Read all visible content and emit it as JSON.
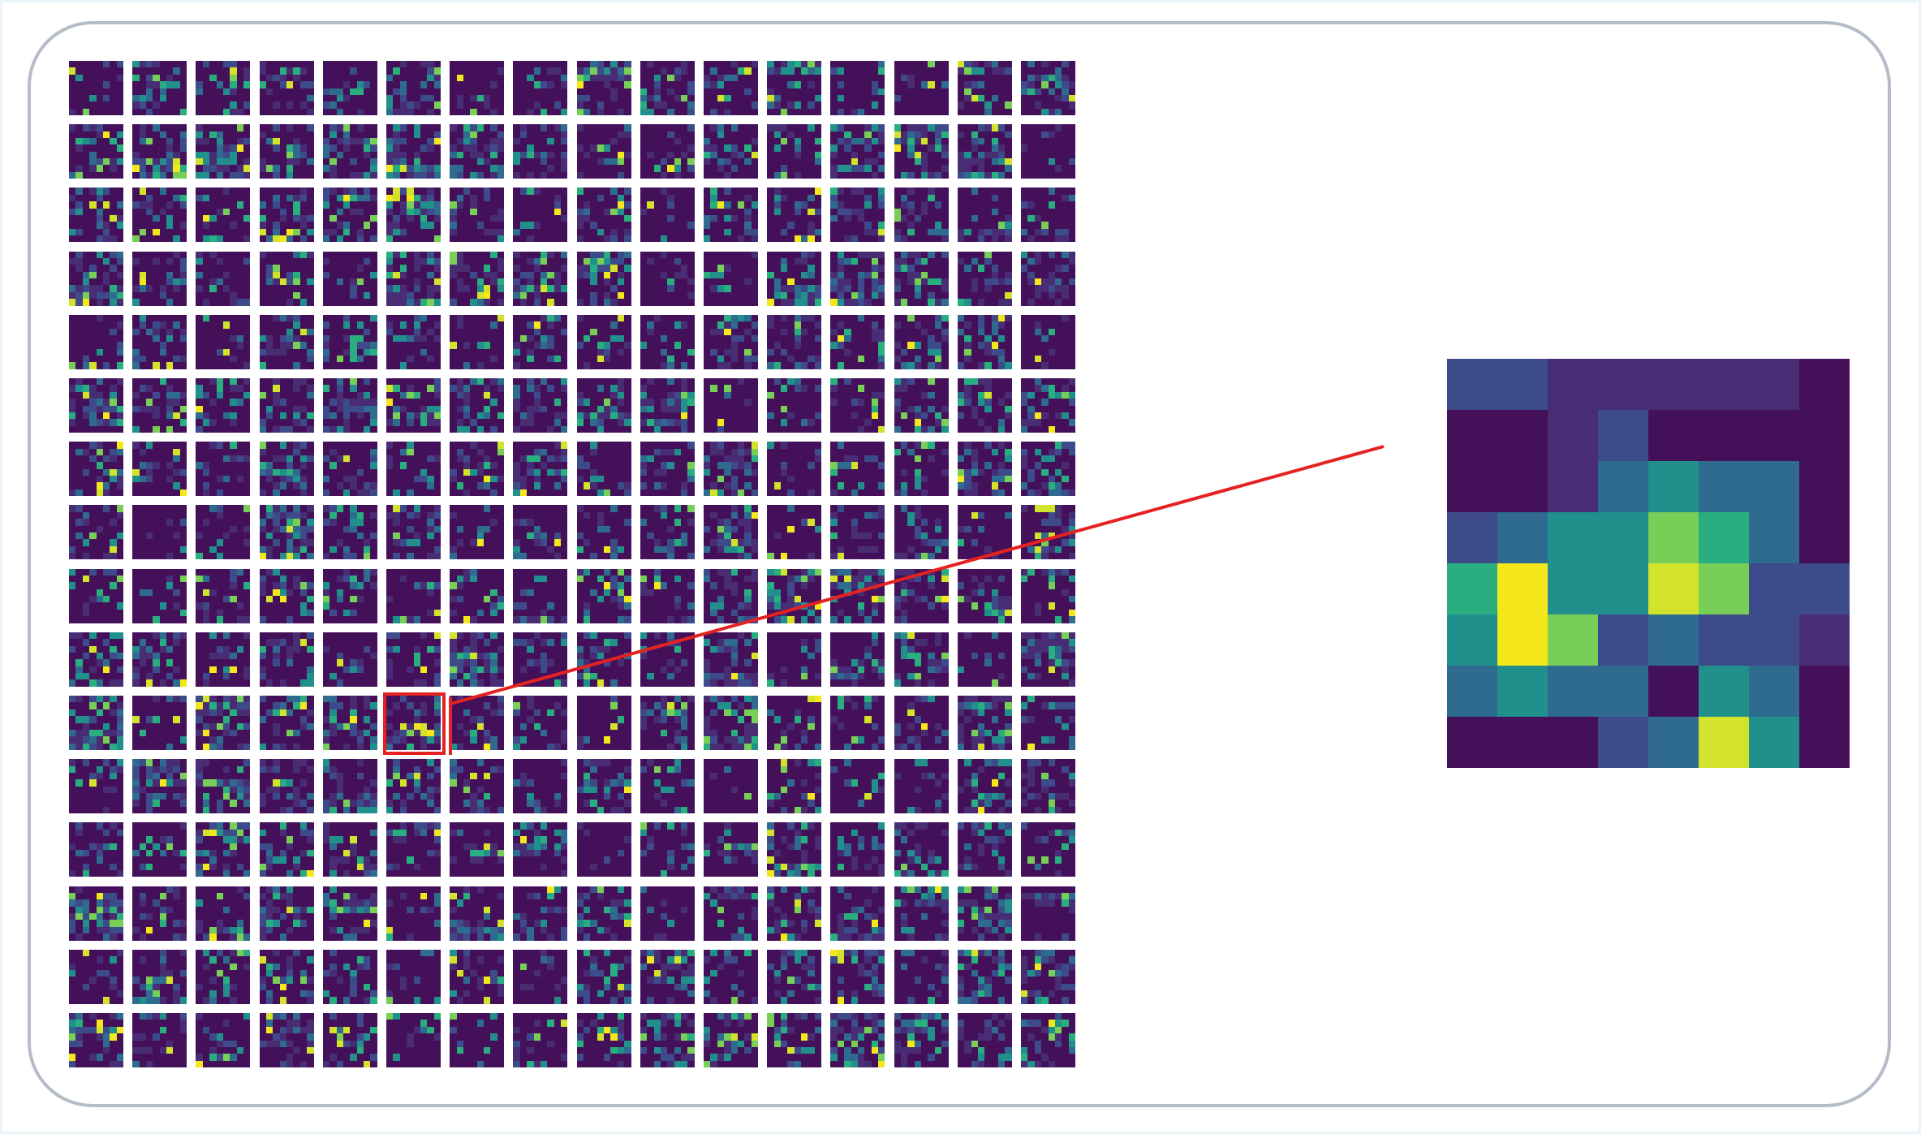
{
  "figure": {
    "grid_rows": 16,
    "grid_cols": 16,
    "cell_resolution": 8,
    "highlighted_cell": {
      "row": 10,
      "col": 5
    },
    "colors": {
      "colormap": [
        "#45105a",
        "#482d75",
        "#3d4b8a",
        "#2e6b8e",
        "#21908d",
        "#29ae80",
        "#77cf57",
        "#d3e22a",
        "#f4e71c"
      ],
      "highlight": "#e52222",
      "panel_border": "#b4bcc8",
      "background": "#e9f3f8"
    },
    "zoomed_map": [
      [
        2,
        2,
        1,
        1,
        1,
        1,
        1,
        0
      ],
      [
        0,
        0,
        1,
        2,
        0,
        0,
        0,
        0
      ],
      [
        0,
        0,
        1,
        3,
        4,
        3,
        3,
        0
      ],
      [
        2,
        3,
        4,
        4,
        6,
        5,
        3,
        0
      ],
      [
        5,
        8,
        4,
        4,
        7,
        6,
        2,
        2
      ],
      [
        4,
        8,
        6,
        2,
        3,
        2,
        2,
        1
      ],
      [
        3,
        4,
        3,
        3,
        0,
        4,
        3,
        0
      ],
      [
        0,
        0,
        0,
        2,
        3,
        7,
        4,
        0
      ]
    ]
  }
}
